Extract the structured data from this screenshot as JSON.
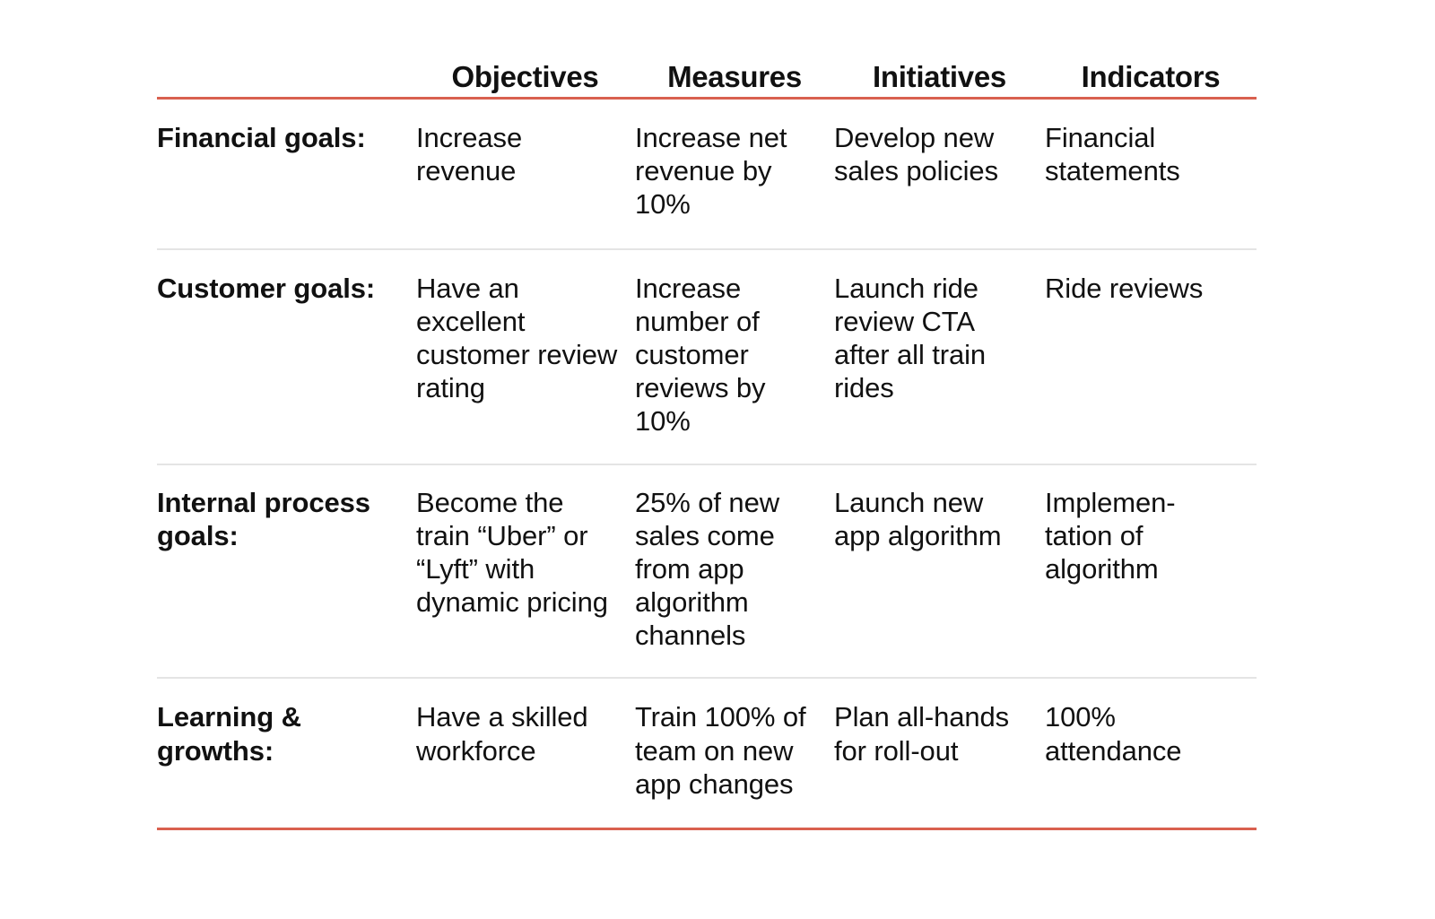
{
  "table": {
    "accent_color": "#d9604f",
    "divider_color": "#e4e4e4",
    "text_color": "#111111",
    "columns": [
      {
        "key": "category",
        "label": ""
      },
      {
        "key": "objectives",
        "label": "Objectives"
      },
      {
        "key": "measures",
        "label": "Measures"
      },
      {
        "key": "initiatives",
        "label": "Initiatives"
      },
      {
        "key": "indicators",
        "label": "Indicators"
      }
    ],
    "rows": [
      {
        "category": "Financial goals:",
        "objectives": "Increase revenue",
        "measures": "Increase net revenue by 10%",
        "initiatives": "Develop new sales policies",
        "indicators": "Financial statements"
      },
      {
        "category": "Customer goals:",
        "objectives": "Have an excellent customer review rating",
        "measures": "Increase number of customer reviews by 10%",
        "initiatives": "Launch ride review CTA after all train rides",
        "indicators": "Ride reviews"
      },
      {
        "category": "Internal process goals:",
        "objectives": "Become the train “Uber” or “Lyft” with dynamic pricing",
        "measures": "25% of new sales come from app algorithm channels",
        "initiatives": "Launch new app algorithm",
        "indicators": "Implemen-\ntation of algorithm"
      },
      {
        "category": "Learning & growths:",
        "objectives": "Have a skilled workforce",
        "measures": "Train 100% of team on new app changes",
        "initiatives": "Plan all-hands for roll-out",
        "indicators": "100% attendance"
      }
    ]
  }
}
